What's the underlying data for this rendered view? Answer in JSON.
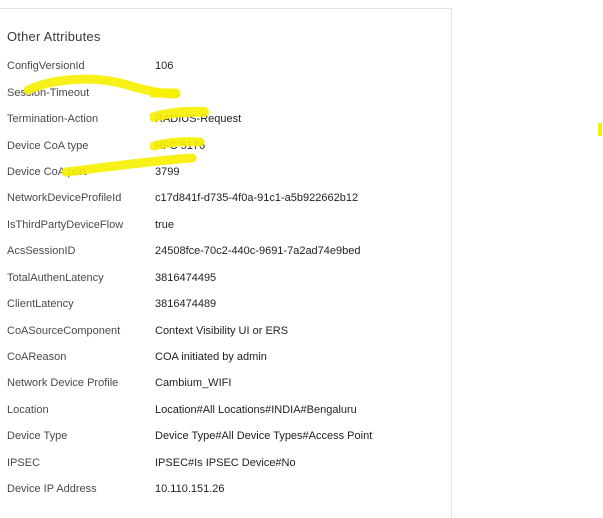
{
  "section": {
    "title": "Other Attributes"
  },
  "attributes": [
    {
      "key": "ConfigVersionId",
      "value": "106"
    },
    {
      "key": "Session-Timeout",
      "value": "1"
    },
    {
      "key": "Termination-Action",
      "value": "RADIUS-Request"
    },
    {
      "key": "Device CoA type",
      "value": "RFC 5176"
    },
    {
      "key": "Device CoA port",
      "value": "3799"
    },
    {
      "key": "NetworkDeviceProfileId",
      "value": "c17d841f-d735-4f0a-91c1-a5b922662b12"
    },
    {
      "key": "IsThirdPartyDeviceFlow",
      "value": "true"
    },
    {
      "key": "AcsSessionID",
      "value": "24508fce-70c2-440c-9691-7a2ad74e9bed"
    },
    {
      "key": "TotalAuthenLatency",
      "value": "3816474495"
    },
    {
      "key": "ClientLatency",
      "value": "3816474489"
    },
    {
      "key": "CoASourceComponent",
      "value": "Context Visibility UI or ERS"
    },
    {
      "key": "CoAReason",
      "value": "COA initiated by admin"
    },
    {
      "key": "Network Device Profile",
      "value": "Cambium_WIFI"
    },
    {
      "key": "Location",
      "value": "Location#All Locations#INDIA#Bengaluru"
    },
    {
      "key": "Device Type",
      "value": "Device Type#All Device Types#Access Point"
    },
    {
      "key": "IPSEC",
      "value": "IPSEC#Is IPSEC Device#No"
    },
    {
      "key": "Device IP Address",
      "value": "10.110.151.26"
    }
  ],
  "colors": {
    "highlight": "#f6f000",
    "panel_border": "#e3e3e3",
    "text": "#2b2b2b"
  }
}
